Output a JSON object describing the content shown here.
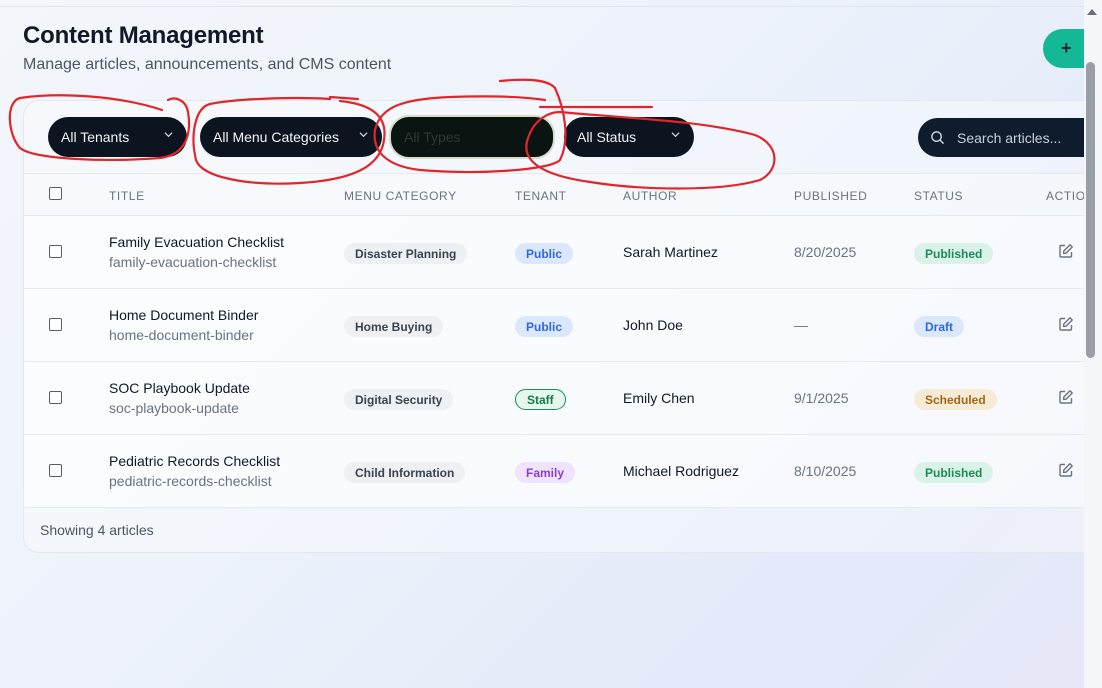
{
  "header": {
    "title": "Content Management",
    "subtitle": "Manage articles, announcements, and CMS content",
    "add_label": "+"
  },
  "filters": {
    "tenant": "All Tenants",
    "menu_category": "All Menu Categories",
    "type": "All Types",
    "status": "All Status",
    "search_placeholder": "Search articles..."
  },
  "table": {
    "columns": [
      "TITLE",
      "MENU CATEGORY",
      "TENANT",
      "AUTHOR",
      "PUBLISHED",
      "STATUS",
      "ACTIO"
    ],
    "rows": [
      {
        "title": "Family Evacuation Checklist",
        "slug": "family-evacuation-checklist",
        "category": "Disaster Planning",
        "tenant": "Public",
        "author": "Sarah Martinez",
        "published": "8/20/2025",
        "status": "Published"
      },
      {
        "title": "Home Document Binder",
        "slug": "home-document-binder",
        "category": "Home Buying",
        "tenant": "Public",
        "author": "John Doe",
        "published": "—",
        "status": "Draft"
      },
      {
        "title": "SOC Playbook Update",
        "slug": "soc-playbook-update",
        "category": "Digital Security",
        "tenant": "Staff",
        "author": "Emily Chen",
        "published": "9/1/2025",
        "status": "Scheduled"
      },
      {
        "title": "Pediatric Records Checklist",
        "slug": "pediatric-records-checklist",
        "category": "Child Information",
        "tenant": "Family",
        "author": "Michael Rodriguez",
        "published": "8/10/2025",
        "status": "Published"
      }
    ]
  },
  "footer": {
    "text": "Showing 4 articles"
  },
  "colors": {
    "accent": "#14b896",
    "filter_bg": "#0c1420",
    "annotation": "#e0262b"
  }
}
